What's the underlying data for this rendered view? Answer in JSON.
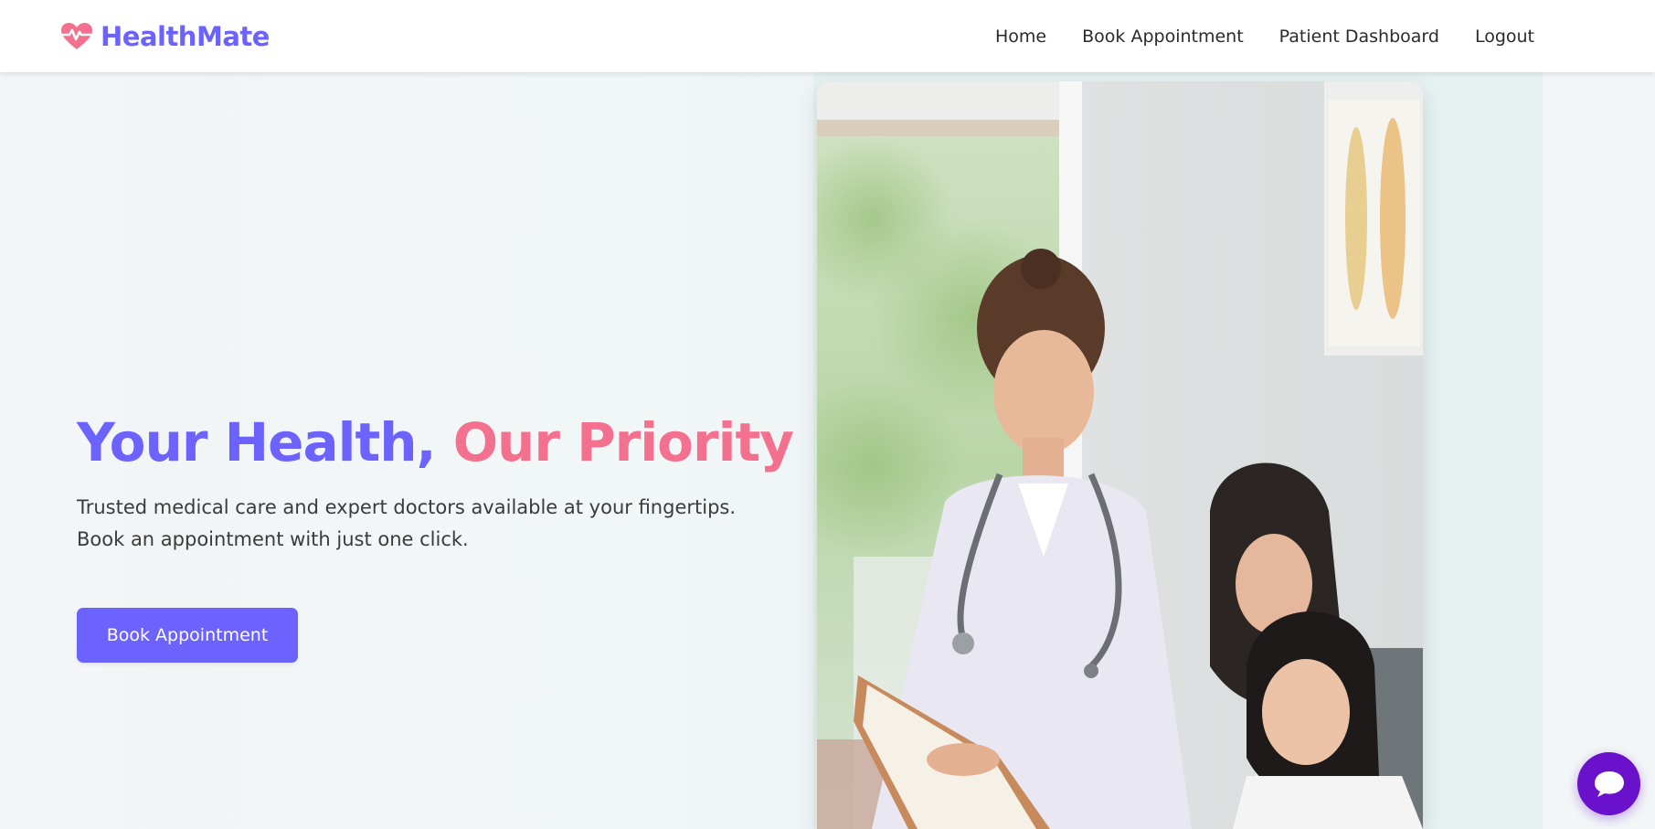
{
  "brand": {
    "name": "HealthMate",
    "icon": "heart-pulse-icon",
    "color": "#6c63ff",
    "icon_color": "#f4708f"
  },
  "nav": {
    "items": [
      {
        "label": "Home"
      },
      {
        "label": "Book Appointment"
      },
      {
        "label": "Patient Dashboard"
      },
      {
        "label": "Logout"
      }
    ]
  },
  "hero": {
    "headline_part1": "Your Health, ",
    "headline_part2": "Our Priority",
    "subtext": "Trusted medical care and expert doctors available at your fingertips. Book an appointment with just one click.",
    "cta_label": "Book Appointment",
    "image": "doctor-with-mother-and-child-photo"
  },
  "chat": {
    "icon": "chat-bubble-icon",
    "color": "#6a11cb"
  },
  "colors": {
    "accent": "#6c63ff",
    "pink": "#f4708f",
    "chat": "#6a11cb"
  }
}
